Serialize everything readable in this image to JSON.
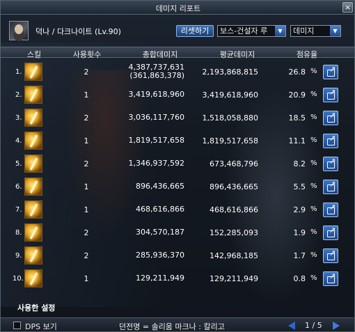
{
  "window": {
    "title": "데미지 리포트",
    "close_label": "×"
  },
  "header": {
    "character": "덕나 / 다크나이트 (Lv.90)",
    "reset_label": "리셋하기",
    "target_select": "보스-건설자 루",
    "metric_select": "데미지"
  },
  "columns": {
    "skill": "스킬",
    "uses": "사용횟수",
    "total": "총합데미지",
    "avg": "평균데미지",
    "share": "점유율"
  },
  "rows": [
    {
      "rank": "1.",
      "uses": "2",
      "total": "4,387,737,631",
      "total_sub": "(361,863,378)",
      "avg": "2,193,868,815",
      "share": "26.8",
      "unit": "%"
    },
    {
      "rank": "2.",
      "uses": "1",
      "total": "3,419,618,960",
      "total_sub": "",
      "avg": "3,419,618,960",
      "share": "20.9",
      "unit": "%"
    },
    {
      "rank": "3.",
      "uses": "2",
      "total": "3,036,117,760",
      "total_sub": "",
      "avg": "1,518,058,880",
      "share": "18.5",
      "unit": "%"
    },
    {
      "rank": "4.",
      "uses": "1",
      "total": "1,819,517,658",
      "total_sub": "",
      "avg": "1,819,517,658",
      "share": "11.1",
      "unit": "%"
    },
    {
      "rank": "5.",
      "uses": "2",
      "total": "1,346,937,592",
      "total_sub": "",
      "avg": "673,468,796",
      "share": "8.2",
      "unit": "%"
    },
    {
      "rank": "6.",
      "uses": "1",
      "total": "896,436,665",
      "total_sub": "",
      "avg": "896,436,665",
      "share": "5.5",
      "unit": "%"
    },
    {
      "rank": "7.",
      "uses": "1",
      "total": "468,616,866",
      "total_sub": "",
      "avg": "468,616,866",
      "share": "2.9",
      "unit": "%"
    },
    {
      "rank": "8.",
      "uses": "2",
      "total": "304,570,187",
      "total_sub": "",
      "avg": "152,285,093",
      "share": "1.9",
      "unit": "%"
    },
    {
      "rank": "9.",
      "uses": "2",
      "total": "285,936,370",
      "total_sub": "",
      "avg": "142,968,185",
      "share": "1.7",
      "unit": "%"
    },
    {
      "rank": "10.",
      "uses": "1",
      "total": "129,211,949",
      "total_sub": "",
      "avg": "129,211,949",
      "share": "0.8",
      "unit": "%"
    }
  ],
  "used_settings_label": "사용한 설정",
  "footer": {
    "dps_label": "DPS 보기",
    "dungeon": "던전명 = 솔리움 마크나 : 칼리고",
    "page": "1 / 5"
  }
}
